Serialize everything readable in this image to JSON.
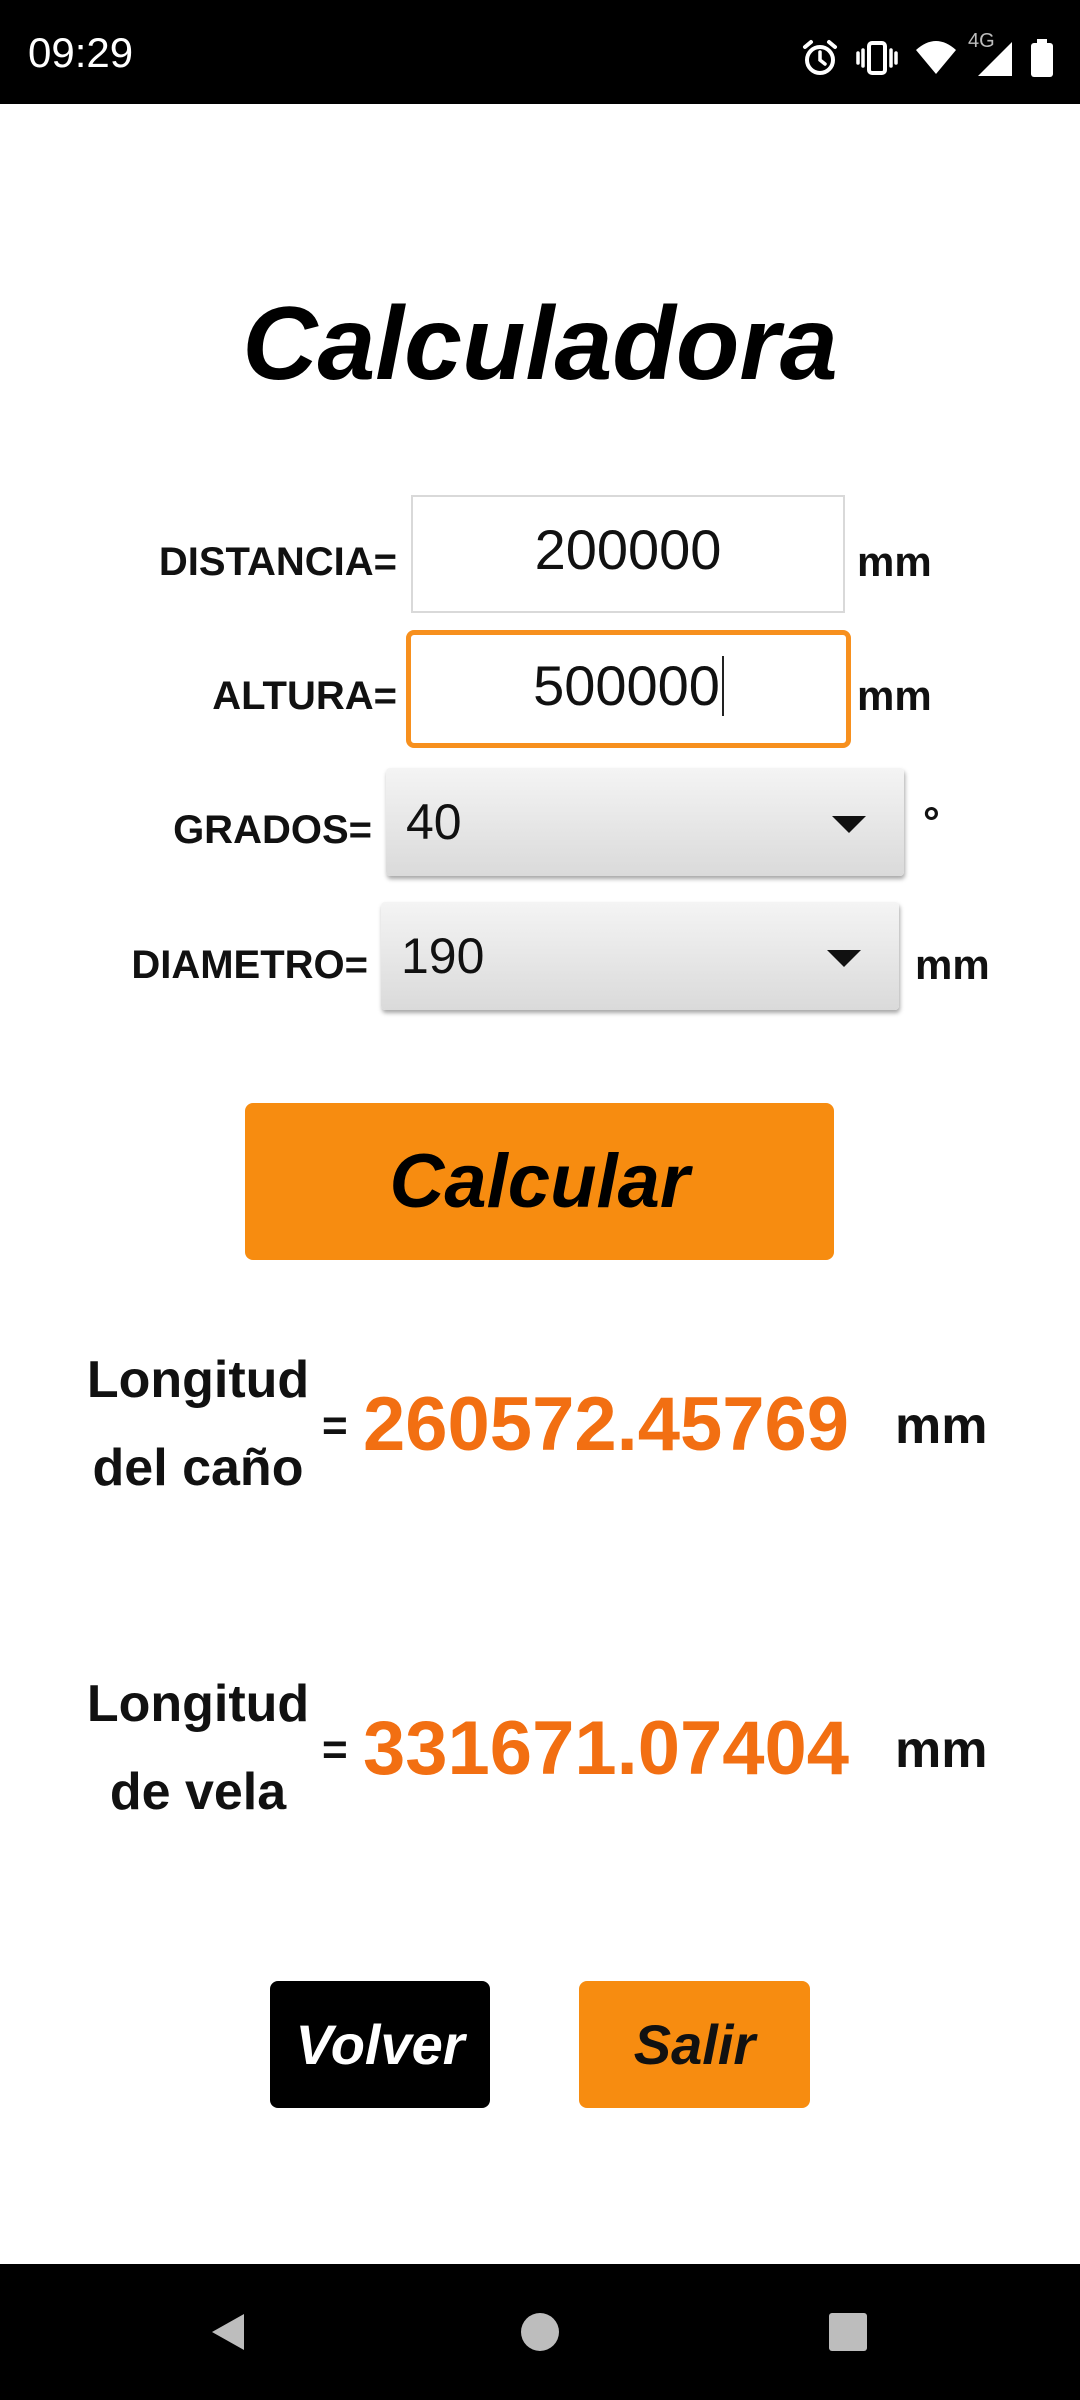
{
  "status_bar": {
    "time": "09:29",
    "network_label": "4G",
    "icons": [
      "alarm-icon",
      "vibrate-icon",
      "wifi-icon",
      "cellular-signal-icon",
      "battery-icon"
    ]
  },
  "title": "Calculadora",
  "form": {
    "distancia": {
      "label": "DISTANCIA=",
      "value": "200000",
      "unit": "mm"
    },
    "altura": {
      "label": "ALTURA=",
      "value": "500000",
      "unit": "mm"
    },
    "grados": {
      "label": "GRADOS=",
      "selected": "40",
      "unit": "°"
    },
    "diametro": {
      "label": "DIAMETRO=",
      "selected": "190",
      "unit": "mm"
    }
  },
  "calc_button_label": "Calcular",
  "results": {
    "cano": {
      "label_line1": "Longitud",
      "label_line2": "del caño",
      "equals": "=",
      "value": "260572.45769",
      "unit": "mm"
    },
    "vela": {
      "label_line1": "Longitud",
      "label_line2": "de vela",
      "equals": "=",
      "value": "331671.07404",
      "unit": "mm"
    }
  },
  "buttons": {
    "volver": "Volver",
    "salir": "Salir"
  },
  "colors": {
    "accent": "#f78c10",
    "result_text": "#f26f12",
    "focus_border": "#f7901e"
  },
  "nav_bar": {
    "icons": [
      "back-icon",
      "home-icon",
      "recents-icon"
    ]
  }
}
